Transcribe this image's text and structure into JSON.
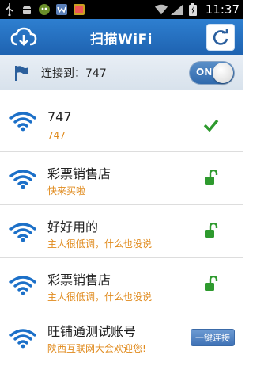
{
  "status_bar": {
    "time": "11:37",
    "left_icons": [
      "usb-icon",
      "android-icon",
      "cat-app-icon",
      "w-app-icon",
      "photo-app-icon"
    ],
    "right_icons": [
      "wifi-signal-icon",
      "cell-signal-icon",
      "battery-icon"
    ]
  },
  "header": {
    "title": "扫描WiFi",
    "logo_icon": "cloud-download-icon",
    "refresh_icon": "refresh-icon"
  },
  "connection": {
    "text": "连接到：747",
    "toggle_label": "ON",
    "toggle_on": true
  },
  "networks": [
    {
      "name": "747",
      "subtitle": "747",
      "status": "connected",
      "status_icon": "checkmark-icon"
    },
    {
      "name": "彩票销售店",
      "subtitle": "快来买啦",
      "status": "open",
      "status_icon": "unlock-icon"
    },
    {
      "name": "好好用的",
      "subtitle": "主人很低调，什么也没说",
      "status": "open",
      "status_icon": "unlock-icon"
    },
    {
      "name": "彩票销售店",
      "subtitle": "主人很低调，什么也没说",
      "status": "open",
      "status_icon": "unlock-icon"
    },
    {
      "name": "旺铺通测试账号",
      "subtitle": "陕西互联网大会欢迎您!",
      "status": "one-key",
      "button_label": "一键连接"
    }
  ],
  "colors": {
    "header": "#1e62b0",
    "wifi_icon": "#1c70c8",
    "subtitle": "#e08a1c",
    "check": "#2e9a2e"
  }
}
